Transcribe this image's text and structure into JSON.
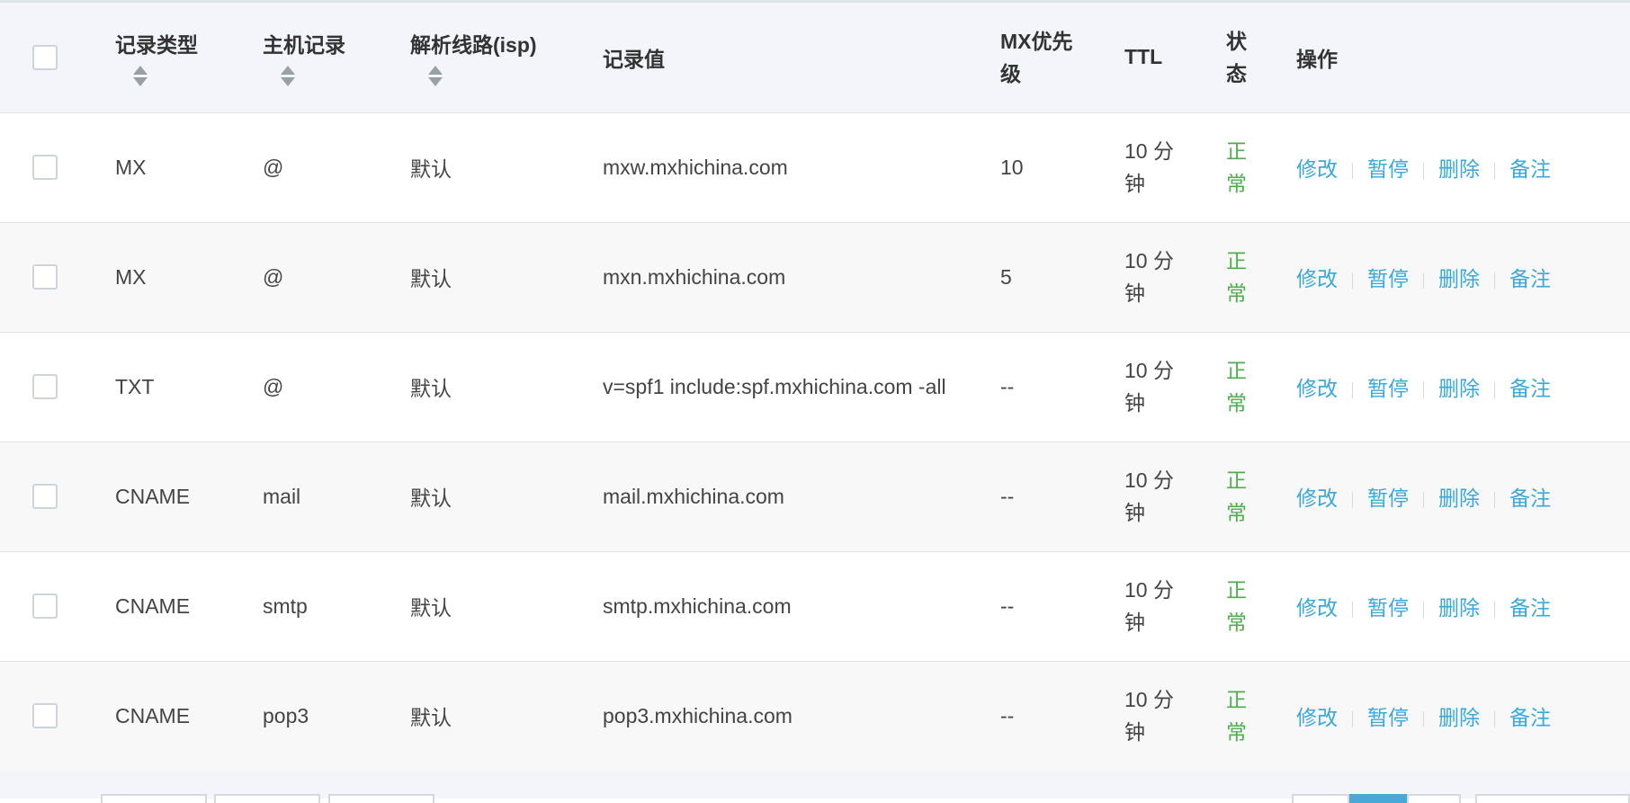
{
  "columns": {
    "type": "记录类型",
    "host": "主机记录",
    "line": "解析线路(isp)",
    "value": "记录值",
    "mx": "MX优先级",
    "ttl": "TTL",
    "status": "状态",
    "actions": "操作"
  },
  "actions": {
    "edit": "修改",
    "pause": "暂停",
    "delete": "删除",
    "note": "备注"
  },
  "colors": {
    "link": "#3aa8d8",
    "status_normal": "#4cae4c",
    "header_bg": "#f3f5fa"
  },
  "rows": [
    {
      "type": "MX",
      "host": "@",
      "line": "默认",
      "value": "mxw.mxhichina.com",
      "mx": "10",
      "ttl": "10 分钟",
      "status": "正常"
    },
    {
      "type": "MX",
      "host": "@",
      "line": "默认",
      "value": "mxn.mxhichina.com",
      "mx": "5",
      "ttl": "10 分钟",
      "status": "正常"
    },
    {
      "type": "TXT",
      "host": "@",
      "line": "默认",
      "value": "v=spf1 include:spf.mxhichina.com -all",
      "mx": "--",
      "ttl": "10 分钟",
      "status": "正常"
    },
    {
      "type": "CNAME",
      "host": "mail",
      "line": "默认",
      "value": "mail.mxhichina.com",
      "mx": "--",
      "ttl": "10 分钟",
      "status": "正常"
    },
    {
      "type": "CNAME",
      "host": "smtp",
      "line": "默认",
      "value": "smtp.mxhichina.com",
      "mx": "--",
      "ttl": "10 分钟",
      "status": "正常"
    },
    {
      "type": "CNAME",
      "host": "pop3",
      "line": "默认",
      "value": "pop3.mxhichina.com",
      "mx": "--",
      "ttl": "10 分钟",
      "status": "正常"
    }
  ]
}
